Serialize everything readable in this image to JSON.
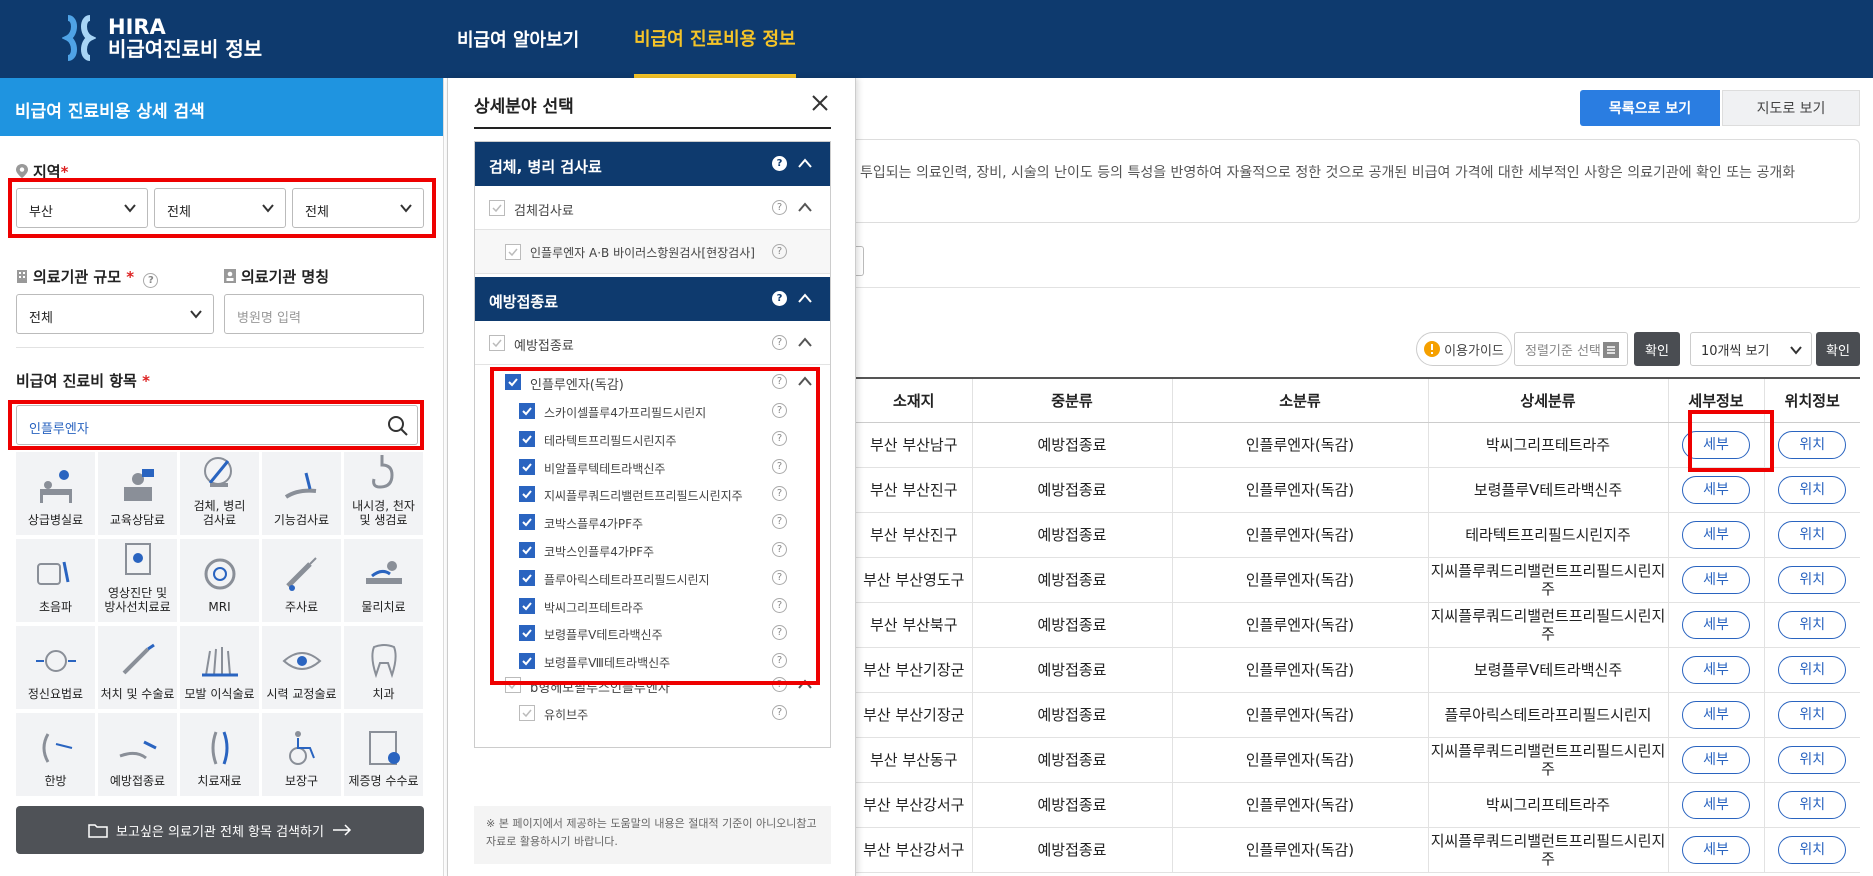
{
  "header": {
    "brand_line1": "HIRA",
    "brand_line2": "비급여진료비 정보",
    "nav": [
      "비급여 알아보기",
      "비급여 진료비용 정보"
    ]
  },
  "left": {
    "title": "비급여 진료비용 상세 검색",
    "region_label": "지역",
    "region_selects": [
      "부산",
      "전체",
      "전체"
    ],
    "scale_label": "의료기관 규모",
    "scale_value": "전체",
    "name_label": "의료기관 명칭",
    "name_placeholder": "병원명 입력",
    "item_label": "비급여 진료비 항목",
    "item_search_value": "인플루엔자",
    "categories": [
      [
        "상급병실료"
      ],
      [
        "교육상담료"
      ],
      [
        "검체, 병리",
        "검사료"
      ],
      [
        "기능검사료"
      ],
      [
        "내시경, 천자",
        "및 생검료"
      ],
      [
        "초음파"
      ],
      [
        "영상진단 및",
        "방사선치료료"
      ],
      [
        "MRI"
      ],
      [
        "주사료"
      ],
      [
        "물리치료"
      ],
      [
        "정신요법료"
      ],
      [
        "처치 및 수술료"
      ],
      [
        "모발 이식술료"
      ],
      [
        "시력 교정술료"
      ],
      [
        "치과"
      ],
      [
        "한방"
      ],
      [
        "예방접종료"
      ],
      [
        "치료재료"
      ],
      [
        "보장구"
      ],
      [
        "제증명 수수료"
      ]
    ],
    "search_all_button": "보고싶은 의료기관 전체 항목 검색하기"
  },
  "modal": {
    "title": "상세분야 선택",
    "cat1": "검체, 병리 검사료",
    "cat1_sub": "검체검사료",
    "cat1_item": "인플루엔자 A·B 바이러스항원검사[현장검사]",
    "cat2": "예방접종료",
    "cat2_sub": "예방접종료",
    "group_label": "인플루엔자(독감)",
    "vaccines": [
      "스카이셀플루4가프리필드시린지",
      "테라텍트프리필드시린지주",
      "비알플루텍테트라백신주",
      "지씨플루쿼드리밸런트프리필드시린지주",
      "코박스플루4가PF주",
      "코박스인플루4가PF주",
      "플루아릭스테트라프리필드시린지",
      "박씨그리프테트라주",
      "보령플루Ⅴ테트라백신주",
      "보령플루Ⅷ테트라백신주"
    ],
    "hib_label": "b형헤모필루스인플루엔자",
    "hib_item": "유히브주",
    "note": "※ 본 페이지에서 제공하는 도움말의 내용은 절대적 기준이 아니오니참고자료로 활용하시기 바랍니다."
  },
  "right": {
    "list_view": "목록으로 보기",
    "map_view": "지도로 보기",
    "notice": "투입되는 의료인력, 장비, 시술의 난이도 등의 특성을 반영하여 자율적으로 정한 것으로 공개된 비급여 가격에 대한 세부적인 사항은 의료기관에 확인 또는 공개화",
    "guide": "이용가이드",
    "sort_placeholder": "정렬기준 선택",
    "confirm": "확인",
    "page_size": "10개씩 보기",
    "columns": [
      "소재지",
      "중분류",
      "소분류",
      "상세분류",
      "세부정보",
      "위치정보"
    ],
    "rows": [
      [
        "부산 부산남구",
        "예방접종료",
        "인플루엔자(독감)",
        "박씨그리프테트라주"
      ],
      [
        "부산 부산진구",
        "예방접종료",
        "인플루엔자(독감)",
        "보령플루Ⅴ테트라백신주"
      ],
      [
        "부산 부산진구",
        "예방접종료",
        "인플루엔자(독감)",
        "테라텍트프리필드시린지주"
      ],
      [
        "부산 부산영도구",
        "예방접종료",
        "인플루엔자(독감)",
        "지씨플루쿼드리밸런트프리필드시린지주"
      ],
      [
        "부산 부산북구",
        "예방접종료",
        "인플루엔자(독감)",
        "지씨플루쿼드리밸런트프리필드시린지주"
      ],
      [
        "부산 부산기장군",
        "예방접종료",
        "인플루엔자(독감)",
        "보령플루Ⅴ테트라백신주"
      ],
      [
        "부산 부산기장군",
        "예방접종료",
        "인플루엔자(독감)",
        "플루아릭스테트라프리필드시린지"
      ],
      [
        "부산 부산동구",
        "예방접종료",
        "인플루엔자(독감)",
        "지씨플루쿼드리밸런트프리필드시린지주"
      ],
      [
        "부산 부산강서구",
        "예방접종료",
        "인플루엔자(독감)",
        "박씨그리프테트라주"
      ],
      [
        "부산 부산강서구",
        "예방접종료",
        "인플루엔자(독감)",
        "지씨플루쿼드리밸런트프리필드시린지주"
      ]
    ],
    "detail_btn": "세부",
    "location_btn": "위치"
  },
  "colors": {
    "header": "#0e3a6e",
    "accent": "#1f94e0",
    "highlight": "#e00000",
    "nav_active": "#f5c428"
  }
}
